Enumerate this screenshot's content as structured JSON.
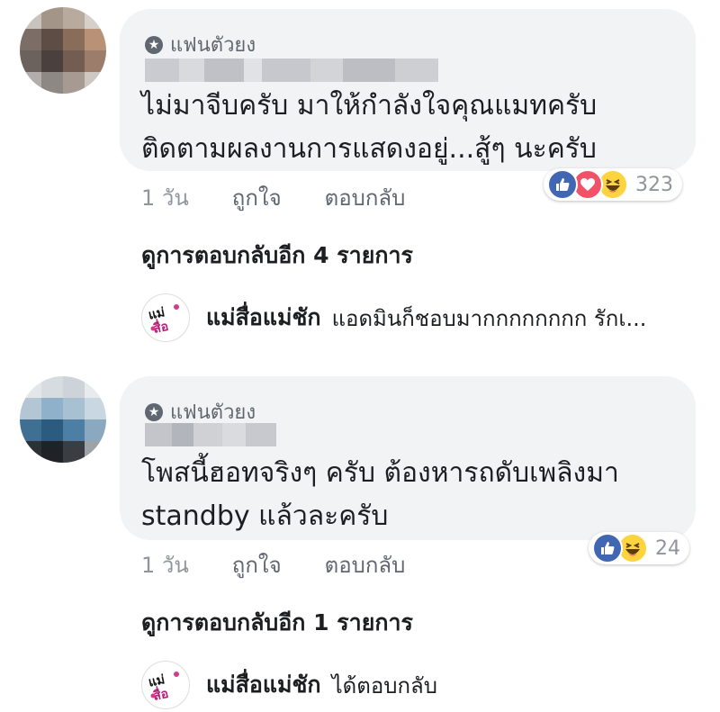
{
  "comments": [
    {
      "badge": "แฟนตัวยง",
      "text_line1": "ไม่มาจีบครับ มาให้กำลังใจคุณแมทครับ",
      "text_line2": "ติดตามผลงานการแสดงอยู่...สู้ๆ นะครับ",
      "time": "1 วัน",
      "like_label": "ถูกใจ",
      "reply_label": "ตอบกลับ",
      "reaction_icons": [
        "like-icon",
        "love-icon",
        "haha-icon"
      ],
      "reaction_count": "323",
      "view_more": "ดูการตอบกลับอีก 4 รายการ",
      "reply_page": "แม่สื่อแม่ชัก",
      "reply_preview": "แอดมินก็ชอบมากกกกกกกก รักเ..."
    },
    {
      "badge": "แฟนตัวยง",
      "text_line1": "โพสนี้ฮอทจริงๆ ครับ ต้องหารถดับเพลิงมา",
      "text_line2": "standby แล้วละครับ",
      "time": "1 วัน",
      "like_label": "ถูกใจ",
      "reply_label": "ตอบกลับ",
      "reaction_icons": [
        "like-icon",
        "haha-icon"
      ],
      "reaction_count": "24",
      "view_more": "ดูการตอบกลับอีก 1 รายการ",
      "reply_page": "แม่สื่อแม่ชัก",
      "reply_preview": "ได้ตอบกลับ"
    }
  ],
  "colors": {
    "bubble": "#f2f3f5",
    "like": "#4267b2",
    "love": "#f25268",
    "haha": "#fcd440",
    "meta": "#90949c"
  }
}
